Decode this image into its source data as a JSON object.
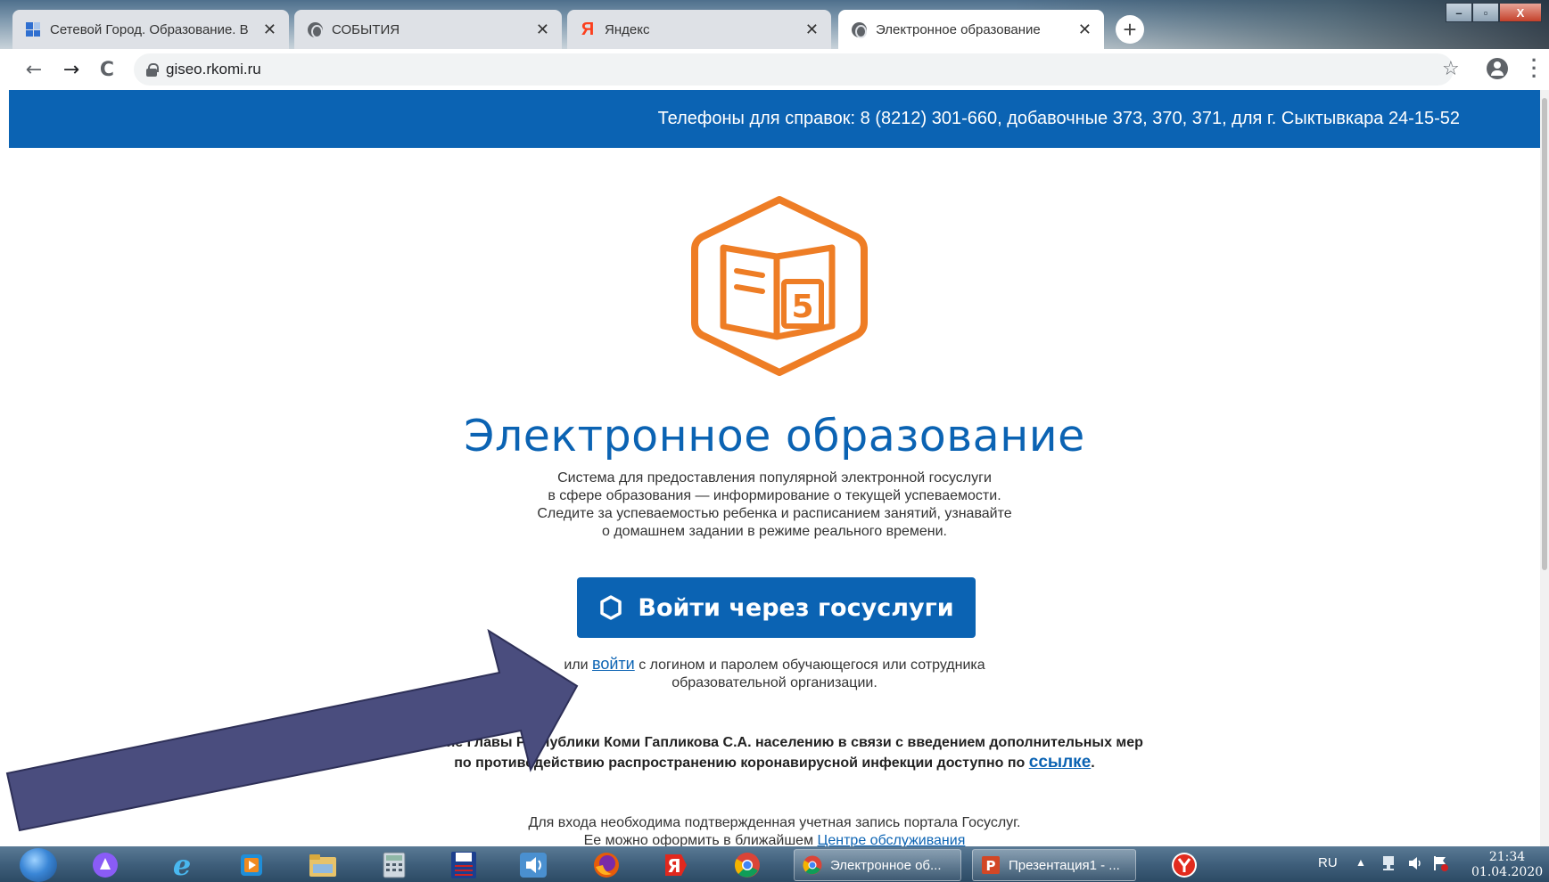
{
  "browser": {
    "tabs": [
      {
        "title": "Сетевой Город. Образование. В",
        "active": false
      },
      {
        "title": "СОБЫТИЯ",
        "active": false
      },
      {
        "title": "Яндекс",
        "active": false
      },
      {
        "title": "Электронное образование",
        "active": true
      }
    ],
    "close_glyph": "✕",
    "new_tab_glyph": "+",
    "url": "giseo.rkomi.ru",
    "nav": {
      "back": "←",
      "forward": "→",
      "reload": "C"
    },
    "window_buttons": {
      "minimize": "–",
      "maximize": "▫",
      "close": "X"
    }
  },
  "page": {
    "info_bar": "Телефоны для справок: 8 (8212) 301-660, добавочные 373, 370, 371, для г. Сыктывкара 24-15-52",
    "logo_digit": "5",
    "title": "Электронное образование",
    "subtitle_lines": [
      "Система для предоставления популярной электронной госуслуги",
      "в сфере образования — информирование о текущей успеваемости.",
      "Следите за успеваемостью ребенка и расписанием занятий, узнавайте",
      "о домашнем задании в режиме реального времени."
    ],
    "gosuslugi_button": "Войти через госуслуги",
    "login": {
      "prefix": "или",
      "link": "войти",
      "suffix": "с логином и паролем обучающегося или сотрудника",
      "line2": "образовательной организации."
    },
    "notice": {
      "line1": "...щение Главы Республики Коми Гапликова С.А. населению в связи с введением дополнительных мер",
      "line2_prefix": "по противодействию распространению коронавирусной инфекции доступно по",
      "link": "ссылке",
      "line2_suffix": "."
    },
    "footer": {
      "line1": "Для входа необходима подтвержденная учетная запись портала Госуслуг.",
      "line2_prefix": "Ее можно оформить в ближайшем",
      "link": "Центре обслуживания"
    },
    "colors": {
      "brand_blue": "#0b63b3",
      "logo_orange": "#ee7d25",
      "arrow_fill": "#4a4d7e"
    }
  },
  "taskbar": {
    "tasks": [
      {
        "label": "Электронное об..."
      },
      {
        "label": "Презентация1 - ..."
      }
    ],
    "tray": {
      "language": "RU",
      "time": "21:34",
      "date": "01.04.2020"
    }
  }
}
